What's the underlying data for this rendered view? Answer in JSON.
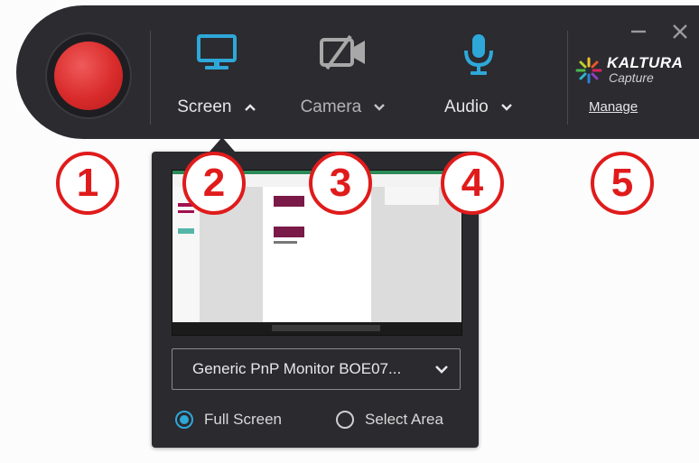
{
  "toolbar": {
    "record_label": "",
    "tools": [
      {
        "label": "Screen",
        "icon": "monitor-icon",
        "chevron": "up"
      },
      {
        "label": "Camera",
        "icon": "camera-off-icon",
        "chevron": "down"
      },
      {
        "label": "Audio",
        "icon": "microphone-icon",
        "chevron": "down"
      }
    ],
    "window_buttons": [
      "minimize-icon",
      "close-icon"
    ],
    "brand": {
      "name": "KALTURA",
      "product": "Capture"
    },
    "manage_label": "Manage",
    "accent_color": "#2ea8d8",
    "record_color": "#d92b2b"
  },
  "callouts": [
    "1",
    "2",
    "3",
    "4",
    "5"
  ],
  "screen_popover": {
    "monitor_select": {
      "value": "Generic PnP Monitor BOE07..."
    },
    "capture_modes": [
      {
        "label": "Full Screen",
        "selected": true
      },
      {
        "label": "Select Area",
        "selected": false
      }
    ]
  }
}
